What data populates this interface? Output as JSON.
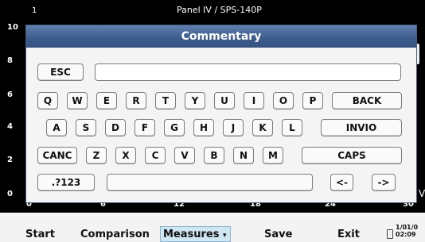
{
  "background": {
    "panel_title": "Panel IV / SPS-140P",
    "y_ticks": [
      "10",
      "8",
      "6",
      "4",
      "2",
      "0"
    ],
    "x_ticks": [
      "0",
      "6",
      "12",
      "18",
      "24",
      "30"
    ],
    "top_tick": "1",
    "unit_label": "V"
  },
  "dialog": {
    "title": "Commentary",
    "input_value": "",
    "row0": {
      "esc": "ESC"
    },
    "row1": [
      "Q",
      "W",
      "E",
      "R",
      "T",
      "Y",
      "U",
      "I",
      "O",
      "P",
      "BACK"
    ],
    "row2": [
      "A",
      "S",
      "D",
      "F",
      "G",
      "H",
      "J",
      "K",
      "L",
      "INVIO"
    ],
    "row3": [
      "CANC",
      "Z",
      "X",
      "C",
      "V",
      "B",
      "N",
      "M",
      "CAPS"
    ],
    "row4": {
      "sym": ".?123",
      "space": "",
      "left": "<-",
      "right": "->"
    }
  },
  "toolbar": {
    "start": "Start",
    "comparison": "Comparison",
    "measures": "Measures",
    "measures_caret": "▾",
    "save": "Save",
    "exit": "Exit",
    "date_line1": "1/01/0",
    "date_line2": "02:09"
  },
  "colors": {
    "titlebar": "#4a6796",
    "active_tab": "#cfe6f3"
  }
}
